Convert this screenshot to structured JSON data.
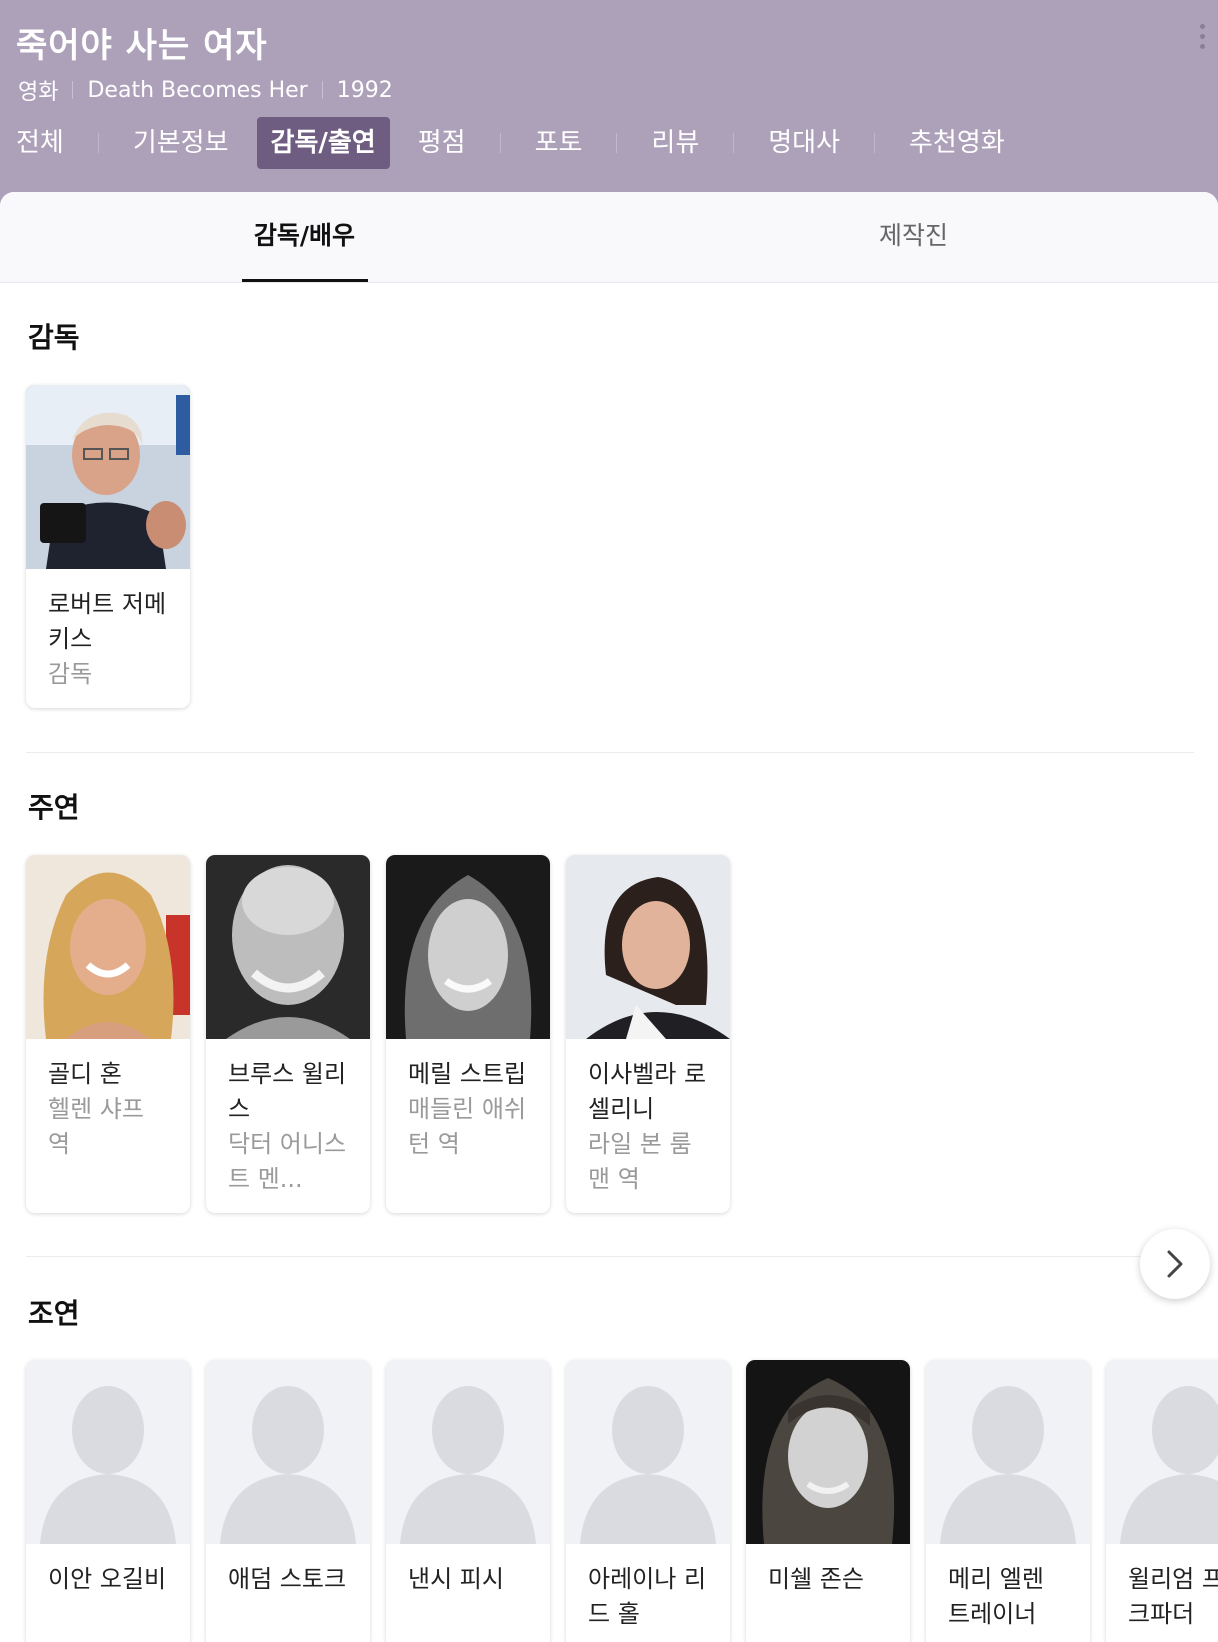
{
  "header": {
    "title": "죽어야 사는 여자",
    "category": "영화",
    "original_title": "Death Becomes Her",
    "year": "1992",
    "more_icon": "more-vertical-icon"
  },
  "tabs": [
    {
      "label": "전체",
      "active": false
    },
    {
      "label": "기본정보",
      "active": false
    },
    {
      "label": "감독/출연",
      "active": true
    },
    {
      "label": "평점",
      "active": false
    },
    {
      "label": "포토",
      "active": false
    },
    {
      "label": "리뷰",
      "active": false
    },
    {
      "label": "명대사",
      "active": false
    },
    {
      "label": "추천영화",
      "active": false
    }
  ],
  "subtabs": [
    {
      "label": "감독/배우",
      "active": true
    },
    {
      "label": "제작진",
      "active": false
    }
  ],
  "sections": {
    "director": {
      "title": "감독",
      "people": [
        {
          "name": "로버트 저메키스",
          "role": "감독",
          "photo": "director-photo"
        }
      ]
    },
    "lead": {
      "title": "주연",
      "people": [
        {
          "name": "골디 혼",
          "role": "헬렌 샤프 역",
          "photo": "actor-photo"
        },
        {
          "name": "브루스 윌리스",
          "role": "닥터 어니스트 멘...",
          "photo": "actor-photo"
        },
        {
          "name": "메릴 스트립",
          "role": "매들린 애쉬턴 역",
          "photo": "actor-photo"
        },
        {
          "name": "이사벨라 로셀리니",
          "role": "라일 본 룸맨 역",
          "photo": "actor-photo"
        }
      ]
    },
    "supporting": {
      "title": "조연",
      "people": [
        {
          "name": "이안 오길비",
          "photo": "placeholder-avatar"
        },
        {
          "name": "애덤 스토크",
          "photo": "placeholder-avatar"
        },
        {
          "name": "낸시 피시",
          "photo": "placeholder-avatar"
        },
        {
          "name": "아레이나 리드 홀",
          "photo": "placeholder-avatar"
        },
        {
          "name": "미쉘 존슨",
          "photo": "actor-photo"
        },
        {
          "name": "메리 엘렌 트레이너",
          "photo": "placeholder-avatar"
        },
        {
          "name": "윌리엄 프랭크파더",
          "photo": "placeholder-avatar"
        }
      ]
    }
  },
  "next_button_icon": "chevron-right-icon",
  "colors": {
    "header_bg": "#ada1ba",
    "active_tab_bg": "#6e5d81",
    "placeholder_bg": "#f1f2f5",
    "placeholder_silhouette": "#d9dbe0"
  }
}
